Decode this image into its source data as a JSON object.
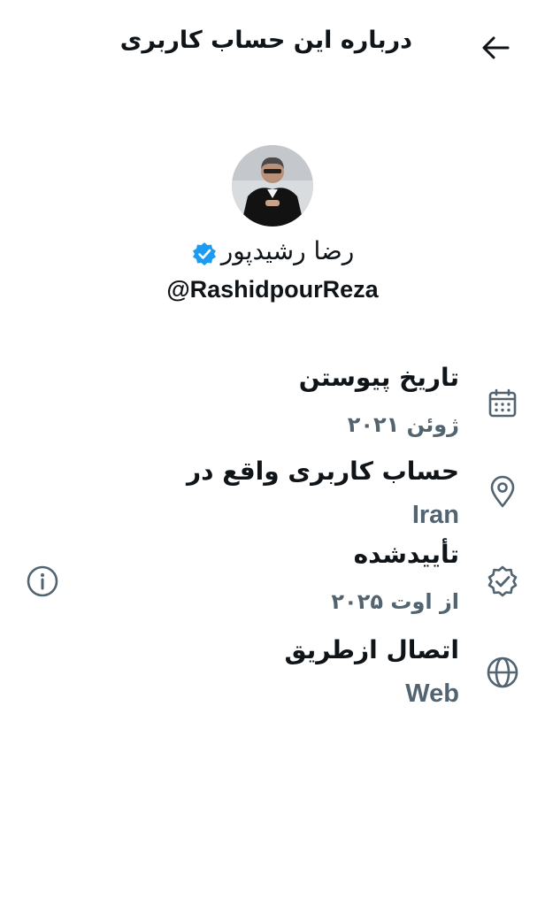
{
  "header": {
    "title": "درباره این حساب کاربری"
  },
  "icons": {
    "back": "arrow-left-icon",
    "verified": "verified-badge-icon",
    "calendar": "calendar-icon",
    "location": "location-pin-icon",
    "verified_row": "verified-check-icon",
    "globe": "globe-icon",
    "info": "info-icon"
  },
  "colors": {
    "verified": "#1d9bf0",
    "secondary_text": "#536471",
    "icon": "#536471"
  },
  "profile": {
    "name": "رضا رشیدپور",
    "handle": "@RashidpourReza"
  },
  "details": {
    "joined": {
      "label": "تاریخ پیوستن",
      "value": "ژوئن ۲۰۲۱"
    },
    "location": {
      "label": "حساب کاربری واقع در",
      "value": "Iran"
    },
    "verified": {
      "label": "تأییدشده",
      "value": "از اوت ۲۰۲۵"
    },
    "connected": {
      "label": "اتصال ازطریق",
      "value": "Web"
    }
  }
}
